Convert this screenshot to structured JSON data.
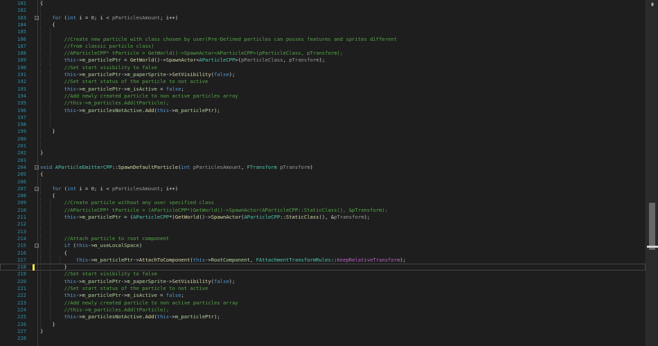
{
  "editor": {
    "split_icon": "split-editor-icon",
    "lines": [
      {
        "n": "181",
        "fold": "",
        "guides": [
          58
        ],
        "spans": [
          [
            "x",
            "{"
          ]
        ]
      },
      {
        "n": "182",
        "fold": "",
        "guides": [
          58
        ],
        "spans": []
      },
      {
        "n": "183",
        "fold": "⊟",
        "guides": [
          58
        ],
        "spans": [
          [
            "x",
            "    "
          ],
          [
            "k",
            "for"
          ],
          [
            "x",
            " ("
          ],
          [
            "k",
            "int"
          ],
          [
            "x",
            " i = "
          ],
          [
            "n",
            "0"
          ],
          [
            "x",
            "; i < "
          ],
          [
            "p",
            "pParticlesAmount"
          ],
          [
            "x",
            "; i++)"
          ]
        ]
      },
      {
        "n": "184",
        "fold": "",
        "guides": [
          58
        ],
        "spans": [
          [
            "x",
            "    {"
          ]
        ]
      },
      {
        "n": "185",
        "fold": "",
        "guides": [
          58,
          72
        ],
        "spans": []
      },
      {
        "n": "186",
        "fold": "",
        "guides": [
          58,
          72
        ],
        "spans": [
          [
            "x",
            "        "
          ],
          [
            "c",
            "//Create new particle with class chosen by user(Pre-Defined particles can posses features and sprites different"
          ]
        ]
      },
      {
        "n": "187",
        "fold": "",
        "guides": [
          58,
          72
        ],
        "spans": [
          [
            "x",
            "        "
          ],
          [
            "c",
            "//from classic particle class)"
          ]
        ]
      },
      {
        "n": "188",
        "fold": "",
        "guides": [
          58,
          72
        ],
        "spans": [
          [
            "x",
            "        "
          ],
          [
            "c",
            "//AParticleCPP* tParticle = GetWorld()->SpawnActor<AParticleCPP>(pParticleClass, pTransform);"
          ]
        ]
      },
      {
        "n": "189",
        "fold": "",
        "guides": [
          58,
          72
        ],
        "spans": [
          [
            "x",
            "        "
          ],
          [
            "k",
            "this"
          ],
          [
            "x",
            "->"
          ],
          [
            "m",
            "m_particlePtr"
          ],
          [
            "x",
            " = "
          ],
          [
            "f",
            "GetWorld"
          ],
          [
            "x",
            "()->"
          ],
          [
            "f",
            "SpawnActor"
          ],
          [
            "x",
            "<"
          ],
          [
            "t",
            "AParticleCPP"
          ],
          [
            "x",
            ">("
          ],
          [
            "p",
            "pParticleClass"
          ],
          [
            "x",
            ", "
          ],
          [
            "p",
            "pTransform"
          ],
          [
            "x",
            ");"
          ]
        ]
      },
      {
        "n": "190",
        "fold": "",
        "guides": [
          58,
          72
        ],
        "spans": [
          [
            "x",
            "        "
          ],
          [
            "c",
            "//Set start visibility to false"
          ]
        ]
      },
      {
        "n": "191",
        "fold": "",
        "guides": [
          58,
          72
        ],
        "spans": [
          [
            "x",
            "        "
          ],
          [
            "k",
            "this"
          ],
          [
            "x",
            "->"
          ],
          [
            "m",
            "m_particlePtr"
          ],
          [
            "x",
            "->"
          ],
          [
            "m",
            "m_paperSprite"
          ],
          [
            "x",
            "->"
          ],
          [
            "f",
            "SetVisibility"
          ],
          [
            "x",
            "("
          ],
          [
            "k",
            "false"
          ],
          [
            "x",
            ");"
          ]
        ]
      },
      {
        "n": "192",
        "fold": "",
        "guides": [
          58,
          72
        ],
        "spans": [
          [
            "x",
            "        "
          ],
          [
            "c",
            "//Set start status of the particle to not active"
          ]
        ]
      },
      {
        "n": "193",
        "fold": "",
        "guides": [
          58,
          72
        ],
        "spans": [
          [
            "x",
            "        "
          ],
          [
            "k",
            "this"
          ],
          [
            "x",
            "->"
          ],
          [
            "m",
            "m_particlePtr"
          ],
          [
            "x",
            "->"
          ],
          [
            "m",
            "m_isActive"
          ],
          [
            "x",
            " = "
          ],
          [
            "k",
            "false"
          ],
          [
            "x",
            ";"
          ]
        ]
      },
      {
        "n": "194",
        "fold": "",
        "guides": [
          58,
          72
        ],
        "spans": [
          [
            "x",
            "        "
          ],
          [
            "c",
            "//Add newly created particle to non active particles array"
          ]
        ]
      },
      {
        "n": "195",
        "fold": "",
        "guides": [
          58,
          72
        ],
        "spans": [
          [
            "x",
            "        "
          ],
          [
            "c",
            "//this->m_particles.Add(tParticle);"
          ]
        ]
      },
      {
        "n": "196",
        "fold": "",
        "guides": [
          58,
          72
        ],
        "spans": [
          [
            "x",
            "        "
          ],
          [
            "k",
            "this"
          ],
          [
            "x",
            "->"
          ],
          [
            "m",
            "m_particlesNotActive"
          ],
          [
            "x",
            "."
          ],
          [
            "f",
            "Add"
          ],
          [
            "x",
            "("
          ],
          [
            "k",
            "this"
          ],
          [
            "x",
            "->"
          ],
          [
            "m",
            "m_particlePtr"
          ],
          [
            "x",
            ");"
          ]
        ]
      },
      {
        "n": "197",
        "fold": "",
        "guides": [
          58,
          72
        ],
        "spans": []
      },
      {
        "n": "198",
        "fold": "",
        "guides": [
          58,
          72
        ],
        "spans": []
      },
      {
        "n": "199",
        "fold": "",
        "guides": [
          58
        ],
        "spans": [
          [
            "x",
            "    }"
          ]
        ]
      },
      {
        "n": "200",
        "fold": "",
        "guides": [
          58
        ],
        "spans": []
      },
      {
        "n": "201",
        "fold": "",
        "guides": [
          58
        ],
        "spans": []
      },
      {
        "n": "202",
        "fold": "",
        "guides": [],
        "spans": [
          [
            "x",
            "}"
          ]
        ]
      },
      {
        "n": "203",
        "fold": "",
        "guides": [],
        "spans": []
      },
      {
        "n": "204",
        "fold": "⊟",
        "guides": [],
        "spans": [
          [
            "k",
            "void"
          ],
          [
            "x",
            " "
          ],
          [
            "t",
            "AParticleEmitterCPP"
          ],
          [
            "x",
            "::"
          ],
          [
            "f",
            "SpawnDefaultParticle"
          ],
          [
            "x",
            "("
          ],
          [
            "k",
            "int"
          ],
          [
            "x",
            " "
          ],
          [
            "p",
            "pParticlesAmount"
          ],
          [
            "x",
            ", "
          ],
          [
            "t",
            "FTransform"
          ],
          [
            "x",
            " "
          ],
          [
            "p",
            "pTransform"
          ],
          [
            "x",
            ")"
          ]
        ]
      },
      {
        "n": "205",
        "fold": "",
        "guides": [],
        "spans": [
          [
            "x",
            "{"
          ]
        ]
      },
      {
        "n": "206",
        "fold": "",
        "guides": [
          58
        ],
        "spans": []
      },
      {
        "n": "207",
        "fold": "⊟",
        "guides": [
          58
        ],
        "spans": [
          [
            "x",
            "    "
          ],
          [
            "k",
            "for"
          ],
          [
            "x",
            " ("
          ],
          [
            "k",
            "int"
          ],
          [
            "x",
            " i = "
          ],
          [
            "n",
            "0"
          ],
          [
            "x",
            "; i < "
          ],
          [
            "p",
            "pParticlesAmount"
          ],
          [
            "x",
            "; i++)"
          ]
        ]
      },
      {
        "n": "208",
        "fold": "",
        "guides": [
          58
        ],
        "spans": [
          [
            "x",
            "    {"
          ]
        ]
      },
      {
        "n": "209",
        "fold": "",
        "guides": [
          58,
          72
        ],
        "spans": [
          [
            "x",
            "        "
          ],
          [
            "c",
            "//Create particle without any user specified class"
          ]
        ]
      },
      {
        "n": "210",
        "fold": "",
        "guides": [
          58,
          72
        ],
        "spans": [
          [
            "x",
            "        "
          ],
          [
            "c",
            "//AParticleCPP* tParticle = (AParticleCPP*)GetWorld()->SpawnActor(AParticleCPP::StaticClass(), &pTransform);"
          ]
        ]
      },
      {
        "n": "211",
        "fold": "",
        "guides": [
          58,
          72
        ],
        "spans": [
          [
            "x",
            "        "
          ],
          [
            "k",
            "this"
          ],
          [
            "x",
            "->"
          ],
          [
            "m",
            "m_particlePtr"
          ],
          [
            "x",
            " = ("
          ],
          [
            "t",
            "AParticleCPP"
          ],
          [
            "x",
            "*)"
          ],
          [
            "f",
            "GetWorld"
          ],
          [
            "x",
            "()->"
          ],
          [
            "f",
            "SpawnActor"
          ],
          [
            "x",
            "("
          ],
          [
            "t",
            "AParticleCPP"
          ],
          [
            "x",
            "::"
          ],
          [
            "f",
            "StaticClass"
          ],
          [
            "x",
            "(), &"
          ],
          [
            "p",
            "pTransform"
          ],
          [
            "x",
            ");"
          ]
        ]
      },
      {
        "n": "212",
        "fold": "",
        "guides": [
          58,
          72
        ],
        "spans": []
      },
      {
        "n": "213",
        "fold": "",
        "guides": [
          58,
          72
        ],
        "spans": []
      },
      {
        "n": "214",
        "fold": "",
        "guides": [
          58,
          72
        ],
        "spans": [
          [
            "x",
            "        "
          ],
          [
            "c",
            "//Attach particle to root component"
          ]
        ]
      },
      {
        "n": "215",
        "fold": "⊟",
        "guides": [
          58,
          72
        ],
        "spans": [
          [
            "x",
            "        "
          ],
          [
            "k",
            "if"
          ],
          [
            "x",
            " ("
          ],
          [
            "k",
            "this"
          ],
          [
            "x",
            "->"
          ],
          [
            "m",
            "m_useLocalSpace"
          ],
          [
            "x",
            ")"
          ]
        ]
      },
      {
        "n": "216",
        "fold": "",
        "guides": [
          58,
          72
        ],
        "spans": [
          [
            "x",
            "        {"
          ]
        ]
      },
      {
        "n": "217",
        "fold": "",
        "guides": [
          58,
          72,
          86
        ],
        "spans": [
          [
            "x",
            "            "
          ],
          [
            "k",
            "this"
          ],
          [
            "x",
            "->"
          ],
          [
            "m",
            "m_particlePtr"
          ],
          [
            "x",
            "->"
          ],
          [
            "f",
            "AttachToComponent"
          ],
          [
            "x",
            "("
          ],
          [
            "k",
            "this"
          ],
          [
            "x",
            "->"
          ],
          [
            "m",
            "RootComponent"
          ],
          [
            "x",
            ", "
          ],
          [
            "t",
            "FAttachmentTransformRules"
          ],
          [
            "x",
            "::"
          ],
          [
            "mac",
            "KeepRelativeTransform"
          ],
          [
            "x",
            ");"
          ]
        ]
      },
      {
        "n": "218",
        "fold": "",
        "guides": [
          58,
          72
        ],
        "current": true,
        "modified": true,
        "spans": [
          [
            "x",
            "        }"
          ]
        ]
      },
      {
        "n": "219",
        "fold": "",
        "guides": [
          58,
          72
        ],
        "spans": [
          [
            "x",
            "        "
          ],
          [
            "c",
            "//Set start visibility to false"
          ]
        ]
      },
      {
        "n": "220",
        "fold": "",
        "guides": [
          58,
          72
        ],
        "spans": [
          [
            "x",
            "        "
          ],
          [
            "k",
            "this"
          ],
          [
            "x",
            "->"
          ],
          [
            "m",
            "m_particlePtr"
          ],
          [
            "x",
            "->"
          ],
          [
            "m",
            "m_paperSprite"
          ],
          [
            "x",
            "->"
          ],
          [
            "f",
            "SetVisibility"
          ],
          [
            "x",
            "("
          ],
          [
            "k",
            "false"
          ],
          [
            "x",
            ");"
          ]
        ]
      },
      {
        "n": "221",
        "fold": "",
        "guides": [
          58,
          72
        ],
        "spans": [
          [
            "x",
            "        "
          ],
          [
            "c",
            "//Set start status of the particle to not active"
          ]
        ]
      },
      {
        "n": "222",
        "fold": "",
        "guides": [
          58,
          72
        ],
        "spans": [
          [
            "x",
            "        "
          ],
          [
            "k",
            "this"
          ],
          [
            "x",
            "->"
          ],
          [
            "m",
            "m_particlePtr"
          ],
          [
            "x",
            "->"
          ],
          [
            "m",
            "m_isActive"
          ],
          [
            "x",
            " = "
          ],
          [
            "k",
            "false"
          ],
          [
            "x",
            ";"
          ]
        ]
      },
      {
        "n": "223",
        "fold": "",
        "guides": [
          58,
          72
        ],
        "spans": [
          [
            "x",
            "        "
          ],
          [
            "c",
            "//Add newly created particle to non active particles array"
          ]
        ]
      },
      {
        "n": "224",
        "fold": "",
        "guides": [
          58,
          72
        ],
        "spans": [
          [
            "x",
            "        "
          ],
          [
            "c",
            "//this->m_particles.Add(tParticle);"
          ]
        ]
      },
      {
        "n": "225",
        "fold": "",
        "guides": [
          58,
          72
        ],
        "spans": [
          [
            "x",
            "        "
          ],
          [
            "k",
            "this"
          ],
          [
            "x",
            "->"
          ],
          [
            "m",
            "m_particlesNotActive"
          ],
          [
            "x",
            "."
          ],
          [
            "f",
            "Add"
          ],
          [
            "x",
            "("
          ],
          [
            "k",
            "this"
          ],
          [
            "x",
            "->"
          ],
          [
            "m",
            "m_particlePtr"
          ],
          [
            "x",
            ");"
          ]
        ]
      },
      {
        "n": "226",
        "fold": "",
        "guides": [
          58
        ],
        "spans": [
          [
            "x",
            "    }"
          ]
        ]
      },
      {
        "n": "227",
        "fold": "",
        "guides": [],
        "spans": [
          [
            "x",
            "}"
          ]
        ]
      },
      {
        "n": "228",
        "fold": "",
        "guides": [],
        "spans": []
      }
    ]
  }
}
